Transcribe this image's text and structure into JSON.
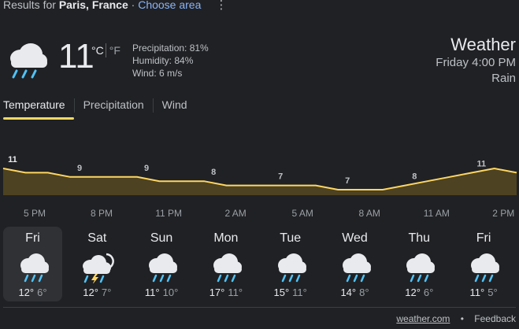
{
  "header": {
    "results_prefix": "Results for",
    "location": "Paris, France",
    "separator": "·",
    "choose_area": "Choose area",
    "more_menu": "⋮"
  },
  "current": {
    "icon": "rain-cloud-icon",
    "temperature": "11",
    "unit_c": "°C",
    "unit_f": "°F",
    "precipitation": "Precipitation: 81%",
    "humidity": "Humidity: 84%",
    "wind": "Wind: 6 m/s",
    "title": "Weather",
    "time": "Friday 4:00 PM",
    "condition": "Rain"
  },
  "tabs": [
    {
      "label": "Temperature",
      "active": true
    },
    {
      "label": "Precipitation",
      "active": false
    },
    {
      "label": "Wind",
      "active": false
    }
  ],
  "chart_data": {
    "type": "area",
    "x": [
      "5 PM",
      "6 PM",
      "7 PM",
      "8 PM",
      "9 PM",
      "10 PM",
      "11 PM",
      "12 AM",
      "1 AM",
      "2 AM",
      "3 AM",
      "4 AM",
      "5 AM",
      "6 AM",
      "7 AM",
      "8 AM",
      "9 AM",
      "10 AM",
      "11 AM",
      "12 PM",
      "1 PM",
      "2 PM",
      "3 PM",
      "4 PM"
    ],
    "values": [
      11,
      10,
      10,
      9,
      9,
      9,
      9,
      8,
      8,
      8,
      7,
      7,
      7,
      7,
      7,
      6,
      6,
      6,
      7,
      8,
      9,
      10,
      11,
      10
    ],
    "labels": [
      {
        "index": 0,
        "text": "11"
      },
      {
        "index": 3,
        "text": "9"
      },
      {
        "index": 6,
        "text": "9"
      },
      {
        "index": 9,
        "text": "8"
      },
      {
        "index": 12,
        "text": "7"
      },
      {
        "index": 15,
        "text": "7"
      },
      {
        "index": 18,
        "text": "8"
      },
      {
        "index": 21,
        "text": "11"
      }
    ],
    "x_ticks": [
      "5 PM",
      "8 PM",
      "11 PM",
      "2 AM",
      "5 AM",
      "8 AM",
      "11 AM",
      "2 PM"
    ],
    "line_color": "#fdd663",
    "fill_color": "#4d4221"
  },
  "forecast": [
    {
      "day": "Fri",
      "icon": "rain-cloud-icon",
      "high": "12°",
      "low": "6°",
      "selected": true
    },
    {
      "day": "Sat",
      "icon": "thunderstorm-cloud-icon",
      "high": "12°",
      "low": "7°",
      "selected": false
    },
    {
      "day": "Sun",
      "icon": "rain-cloud-icon",
      "high": "11°",
      "low": "10°",
      "selected": false
    },
    {
      "day": "Mon",
      "icon": "rain-cloud-icon",
      "high": "17°",
      "low": "11°",
      "selected": false
    },
    {
      "day": "Tue",
      "icon": "rain-cloud-icon",
      "high": "15°",
      "low": "11°",
      "selected": false
    },
    {
      "day": "Wed",
      "icon": "rain-cloud-icon",
      "high": "14°",
      "low": "8°",
      "selected": false
    },
    {
      "day": "Thu",
      "icon": "rain-cloud-icon",
      "high": "12°",
      "low": "6°",
      "selected": false
    },
    {
      "day": "Fri",
      "icon": "rain-cloud-icon",
      "high": "11°",
      "low": "5°",
      "selected": false
    }
  ],
  "footer": {
    "source": "weather.com",
    "dot": "•",
    "feedback": "Feedback"
  },
  "colors": {
    "background": "#202124",
    "accent": "#fdd663",
    "link": "#8ab4f8",
    "rain": "#4fc3f7"
  }
}
